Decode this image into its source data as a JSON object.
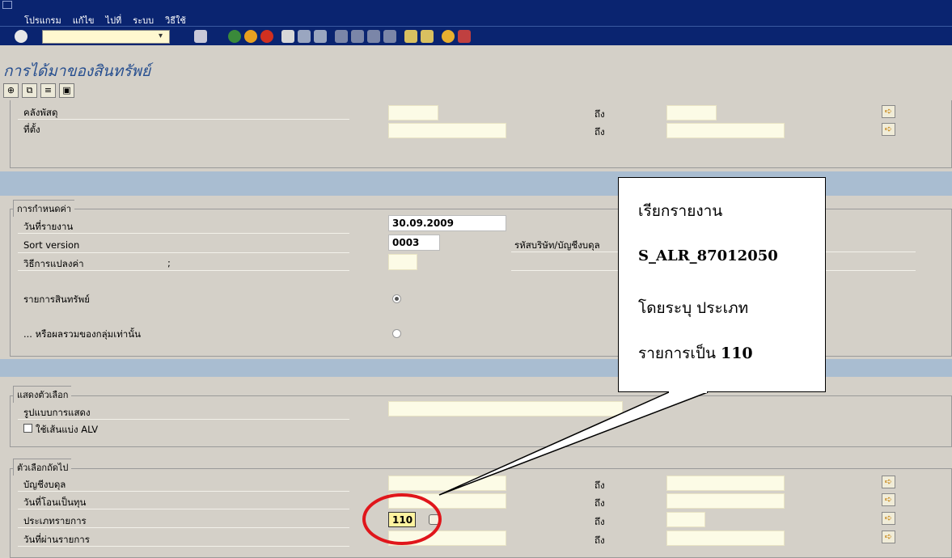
{
  "menu": {
    "items": [
      "โปรแกรม",
      "แก้ไข",
      "ไปที่",
      "ระบบ",
      "วิธีใช้"
    ]
  },
  "page_title": "การได้มาของสินทรัพย์",
  "top": {
    "rows": [
      {
        "label": "คลังพัสดุ",
        "to": "ถึง"
      },
      {
        "label": "ที่ตั้ง",
        "to": "ถึง"
      }
    ]
  },
  "settings": {
    "group_title": "การกำหนดค่า",
    "report_date_label": "วันที่รายงาน",
    "report_date": "30.09.2009",
    "sort_version_label": "Sort version",
    "sort_version": "0003",
    "company_label": "รหัสบริษัท/บัญชีงบดุล",
    "valuation_label": "วิธีการแปลงค่า",
    "valuation_semicolon": ";",
    "asset_list_label": "รายการสินทรัพย์",
    "group_totals_label": "... หรือผลรวมของกลุ่มเท่านั้น"
  },
  "display": {
    "group_title": "แสดงตัวเลือก",
    "layout_label": "รูปแบบการแสดง",
    "alv_label": "ใช้เส้นแบ่ง ALV"
  },
  "further": {
    "group_title": "ตัวเลือกถัดไป",
    "rows": [
      {
        "label": "บัญชีงบดุล",
        "to": "ถึง",
        "value": ""
      },
      {
        "label": "วันที่โอนเป็นทุน",
        "to": "ถึง",
        "value": ""
      },
      {
        "label": "ประเภทรายการ",
        "to": "ถึง",
        "value": "110"
      },
      {
        "label": "วันที่ผ่านรายการ",
        "to": "ถึง",
        "value": ""
      }
    ]
  },
  "callout": {
    "line1": "เรียกรายงาน",
    "line2": "S_ALR_87012050",
    "line3": "โดยระบุ ประเภท",
    "line4_text": "รายการเป็น ",
    "line4_bold": "110"
  },
  "colors": {
    "accent_red": "#e0161b",
    "title_blue": "#264e8f",
    "menubar": "#0a2470"
  }
}
